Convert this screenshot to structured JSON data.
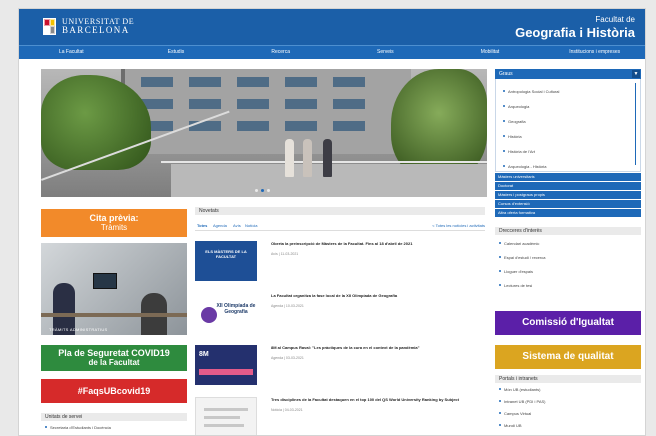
{
  "header": {
    "logo_line1": "UNIVERSITAT DE",
    "logo_line2": "BARCELONA",
    "faculty_line1": "Facultat de",
    "faculty_line2": "Geografia i Història"
  },
  "nav": [
    "La Facultat",
    "Estudis",
    "Recerca",
    "Serveis",
    "Mobilitat",
    "Institucions i empreses"
  ],
  "hero": {
    "dots": 3,
    "active_dot": 1
  },
  "promo": {
    "cita_line1": "Cita prèvia:",
    "cita_line2": "Tràmits",
    "photo_caption": "TRÀMITS ADMINISTRATIUS",
    "covid_line1": "Pla de Seguretat COVID19",
    "covid_line2": "de la Facultat",
    "faqs": "#FaqsUBcovid19"
  },
  "units": {
    "title": "Unitats de servei",
    "items": [
      "Secretaria d'Estudiants i Docència"
    ]
  },
  "news": {
    "title": "Novetats",
    "tabs": [
      "Totes",
      "Agenda",
      "Avís",
      "Notícia"
    ],
    "all_link": "< Totes les notícies i activitats",
    "items": [
      {
        "title": "Oberta la preinscripció de Màsters de la Facultat. Fins al 18 d'abril de 2021",
        "meta": "Avís | 11-03-2021",
        "thumb": "ELS MÀSTERS DE LA FACULTAT"
      },
      {
        "title": "La Facultat organitza la fase local de la XII Olimpíada de Geografia",
        "meta": "Agenda | 10-03-2021",
        "thumb": "XII Olimpíada de Geografia"
      },
      {
        "title": "8M al Campus Raval: \"Les pràctiques de la cura en el context de la pandèmia\"",
        "meta": "Agenda | 03-03-2021",
        "thumb": "8M"
      },
      {
        "title": "Tres disciplines de la Facultat destaquen en el top 100 del QS World University Ranking by Subject",
        "meta": "Notícia | 04-03-2021",
        "thumb": ""
      }
    ]
  },
  "sidebar": {
    "title": "Graus",
    "degrees": [
      "Antropologia Social i Cultural",
      "Arqueologia",
      "Geografia",
      "Història",
      "Història de l'Art",
      "Arqueologia - Història"
    ],
    "buttons": [
      "Màsters universitaris",
      "Doctorat",
      "Màsters i postgraus propis",
      "Cursos d'extensió",
      "Altra oferta formativa"
    ],
    "interest_title": "Drecceres d'interès",
    "interest_items": [
      "Calendari acadèmic",
      "Espai d'estudi / recerca",
      "Lloguer d'espais",
      "Lectures de tesi"
    ],
    "comissio": "Comissió d'Igualtat",
    "qualitat": "Sistema de qualitat",
    "intranet_title": "Portals i intranets",
    "intranet_items": [
      "Món UB (estudiants)",
      "Intranet UB (PDI i PAS)",
      "Campus Virtual",
      "Mundi UB"
    ]
  },
  "colors": {
    "primary": "#1b5fa8",
    "orange": "#f28a2a",
    "green": "#2e8b3e",
    "red": "#d62a2a",
    "purple": "#5b1fa8",
    "gold": "#dba520"
  }
}
